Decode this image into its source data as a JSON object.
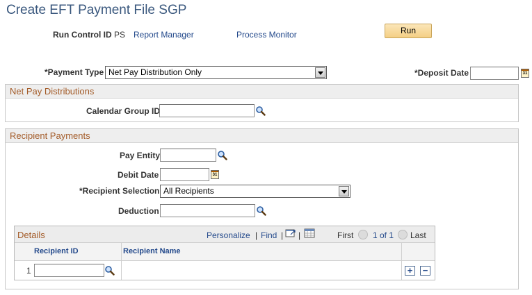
{
  "page": {
    "title": "Create EFT Payment File SGP"
  },
  "run_control": {
    "label": "Run Control ID",
    "value": "PS",
    "report_manager": "Report Manager",
    "process_monitor": "Process Monitor",
    "run_button": "Run"
  },
  "payment": {
    "payment_type_label": "*Payment Type",
    "payment_type_value": "Net Pay Distribution Only",
    "deposit_date_label": "*Deposit Date",
    "deposit_date_value": ""
  },
  "net_pay": {
    "header": "Net Pay Distributions",
    "calendar_group_label": "Calendar Group ID",
    "calendar_group_value": ""
  },
  "recipient": {
    "header": "Recipient Payments",
    "pay_entity_label": "Pay Entity",
    "pay_entity_value": "",
    "debit_date_label": "Debit Date",
    "debit_date_value": "",
    "recipient_selection_label": "*Recipient Selection",
    "recipient_selection_value": "All Recipients",
    "deduction_label": "Deduction",
    "deduction_value": ""
  },
  "details": {
    "title": "Details",
    "personalize": "Personalize",
    "separator": "|",
    "find": "Find",
    "first": "First",
    "range": "1 of 1",
    "last": "Last",
    "columns": [
      "Recipient ID",
      "Recipient Name"
    ],
    "rows": [
      {
        "num": "1",
        "recipient_id": "",
        "recipient_name": ""
      }
    ],
    "add_symbol": "+",
    "remove_symbol": "−"
  },
  "icons": {
    "calendar": "calendar-icon",
    "lookup": "magnifier-icon",
    "view_all": "view-all-icon",
    "download": "grid-download-icon"
  },
  "colors": {
    "title": "#39577d",
    "link": "#23498b",
    "section_header": "#a35b28",
    "run_button": "#f4cf85"
  }
}
